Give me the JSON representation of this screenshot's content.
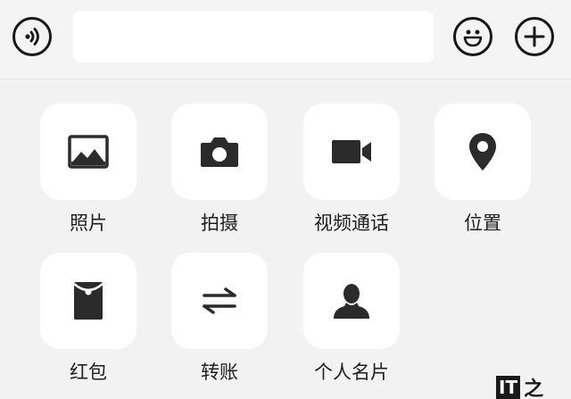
{
  "input_bar": {
    "voice_icon": "voice-icon",
    "emoji_icon": "emoji-icon",
    "plus_icon": "plus-icon",
    "message_value": ""
  },
  "panel": {
    "items": [
      {
        "label": "照片",
        "icon": "image-icon"
      },
      {
        "label": "拍摄",
        "icon": "camera-icon"
      },
      {
        "label": "视频通话",
        "icon": "video-call-icon"
      },
      {
        "label": "位置",
        "icon": "location-pin-icon"
      },
      {
        "label": "红包",
        "icon": "red-packet-icon"
      },
      {
        "label": "转账",
        "icon": "transfer-icon"
      },
      {
        "label": "个人名片",
        "icon": "contact-card-icon"
      }
    ]
  },
  "watermark": {
    "brand": "IT",
    "suffix": "之"
  },
  "colors": {
    "background": "#f2f2f2",
    "tile": "#ffffff",
    "icon": "#2b2b2b",
    "text": "#1f1f1f"
  }
}
